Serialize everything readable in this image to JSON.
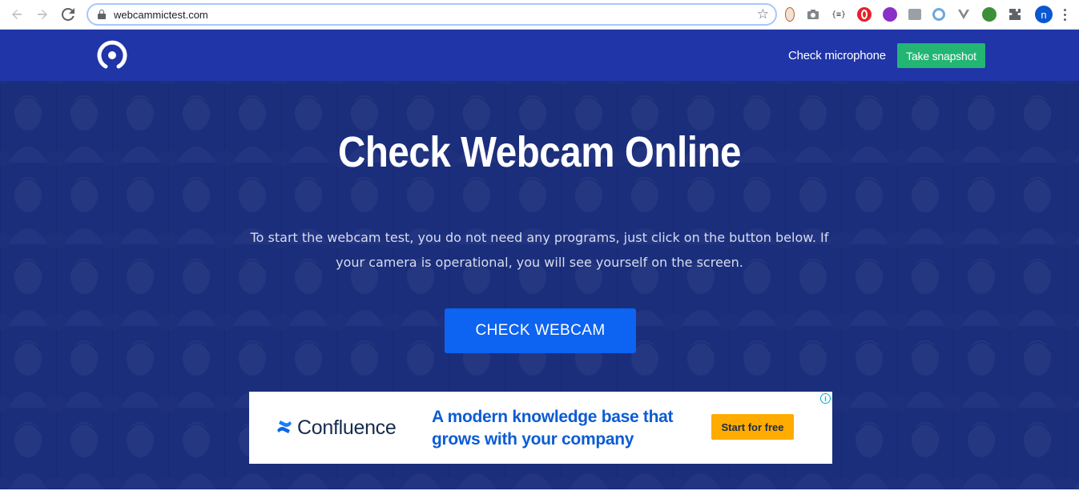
{
  "browser": {
    "url": "webcammictest.com",
    "back_icon": "arrow-left-icon",
    "forward_icon": "arrow-right-icon",
    "reload_icon": "reload-icon",
    "profile_initial": "n",
    "extensions": [
      "extension-1",
      "camera-icon",
      "json-icon",
      "opera-icon",
      "extension-purple",
      "extension-grid",
      "extension-circle",
      "vpn-icon",
      "extension-globe",
      "puzzle-icon"
    ]
  },
  "header": {
    "check_microphone": "Check microphone",
    "take_snapshot": "Take snapshot",
    "accent": "#1f35a8",
    "snapshot_color": "#22b573"
  },
  "hero": {
    "title": "Check Webcam Online",
    "text": "To start the webcam test, you do not need any programs, just click on the button below. If your camera is operational, you will see yourself on the screen.",
    "cta": "CHECK WEBCAM",
    "cta_color": "#0d63f2"
  },
  "ad": {
    "brand": "Confluence",
    "headline": "A modern knowledge base that grows with your company",
    "button": "Start for free",
    "info_icon": "info-icon"
  }
}
